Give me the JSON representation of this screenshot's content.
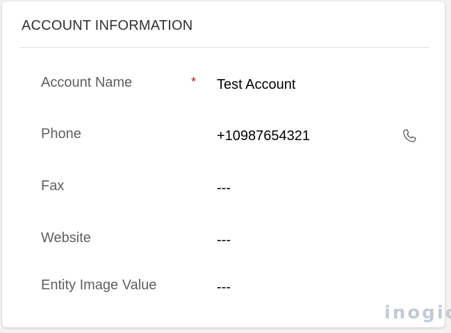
{
  "section": {
    "title": "ACCOUNT INFORMATION"
  },
  "fields": [
    {
      "label": "Account Name",
      "required_marker": "*",
      "value": "Test Account"
    },
    {
      "label": "Phone",
      "value": "+10987654321",
      "action_icon": "phone-icon"
    },
    {
      "label": "Fax",
      "value": "---"
    },
    {
      "label": "Website",
      "value": "---"
    },
    {
      "label": "Entity Image Value",
      "value": "---"
    }
  ],
  "watermark": {
    "text": "inogic"
  },
  "colors": {
    "required": "#a4262c",
    "label": "#605e5c",
    "value": "#000000",
    "watermark": "#c4c9d6"
  }
}
